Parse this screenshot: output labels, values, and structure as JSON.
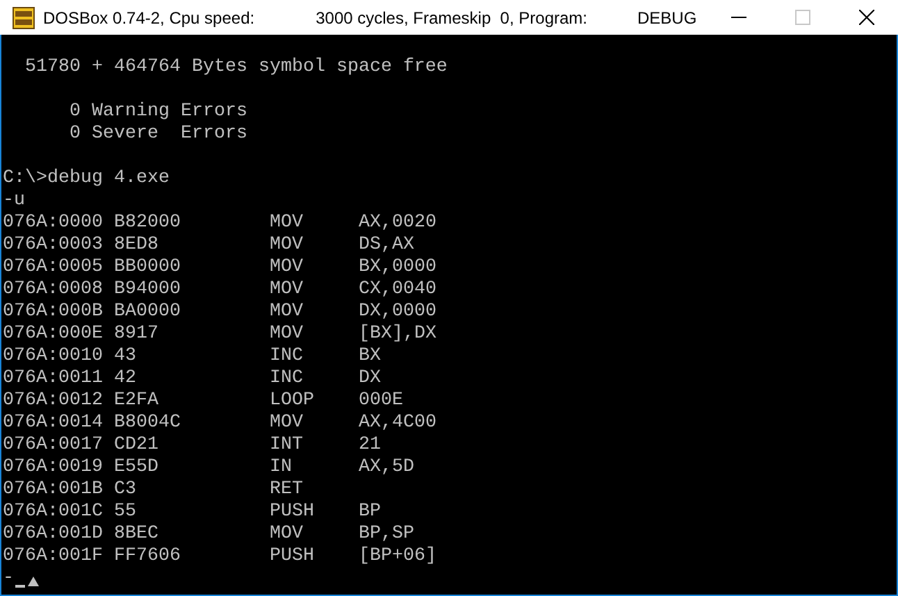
{
  "window": {
    "title_parts": [
      "DOSBox 0.74-2, Cpu speed:",
      "3000 cycles, Frameskip  0, Program:",
      "DEBUG"
    ],
    "controls": [
      {
        "kind": "minimize",
        "disabled": false
      },
      {
        "kind": "maximize",
        "disabled": true
      },
      {
        "kind": "close",
        "disabled": false
      }
    ]
  },
  "console": {
    "banner": "51780 + 464764 Bytes symbol space free",
    "summary": [
      "0 Warning Errors",
      "0 Severe  Errors"
    ],
    "prompt": "C:\\>debug 4.exe",
    "command": "-u",
    "rows": [
      {
        "address": "076A:0000",
        "bytes": "B82000",
        "mnemonic": "MOV",
        "operands": "AX,0020"
      },
      {
        "address": "076A:0003",
        "bytes": "8ED8",
        "mnemonic": "MOV",
        "operands": "DS,AX"
      },
      {
        "address": "076A:0005",
        "bytes": "BB0000",
        "mnemonic": "MOV",
        "operands": "BX,0000"
      },
      {
        "address": "076A:0008",
        "bytes": "B94000",
        "mnemonic": "MOV",
        "operands": "CX,0040"
      },
      {
        "address": "076A:000B",
        "bytes": "BA0000",
        "mnemonic": "MOV",
        "operands": "DX,0000"
      },
      {
        "address": "076A:000E",
        "bytes": "8917",
        "mnemonic": "MOV",
        "operands": "[BX],DX"
      },
      {
        "address": "076A:0010",
        "bytes": "43",
        "mnemonic": "INC",
        "operands": "BX"
      },
      {
        "address": "076A:0011",
        "bytes": "42",
        "mnemonic": "INC",
        "operands": "DX"
      },
      {
        "address": "076A:0012",
        "bytes": "E2FA",
        "mnemonic": "LOOP",
        "operands": "000E"
      },
      {
        "address": "076A:0014",
        "bytes": "B8004C",
        "mnemonic": "MOV",
        "operands": "AX,4C00"
      },
      {
        "address": "076A:0017",
        "bytes": "CD21",
        "mnemonic": "INT",
        "operands": "21"
      },
      {
        "address": "076A:0019",
        "bytes": "E55D",
        "mnemonic": "IN",
        "operands": "AX,5D"
      },
      {
        "address": "076A:001B",
        "bytes": "C3",
        "mnemonic": "RET"
      },
      {
        "address": "076A:001C",
        "bytes": "55",
        "mnemonic": "PUSH",
        "operands": "BP"
      },
      {
        "address": "076A:001D",
        "bytes": "8BEC",
        "mnemonic": "MOV",
        "operands": "BP,SP"
      },
      {
        "address": "076A:001F",
        "bytes": "FF7606",
        "mnemonic": "PUSH",
        "operands": "[BP+06]"
      }
    ],
    "input_prompt": "-"
  }
}
